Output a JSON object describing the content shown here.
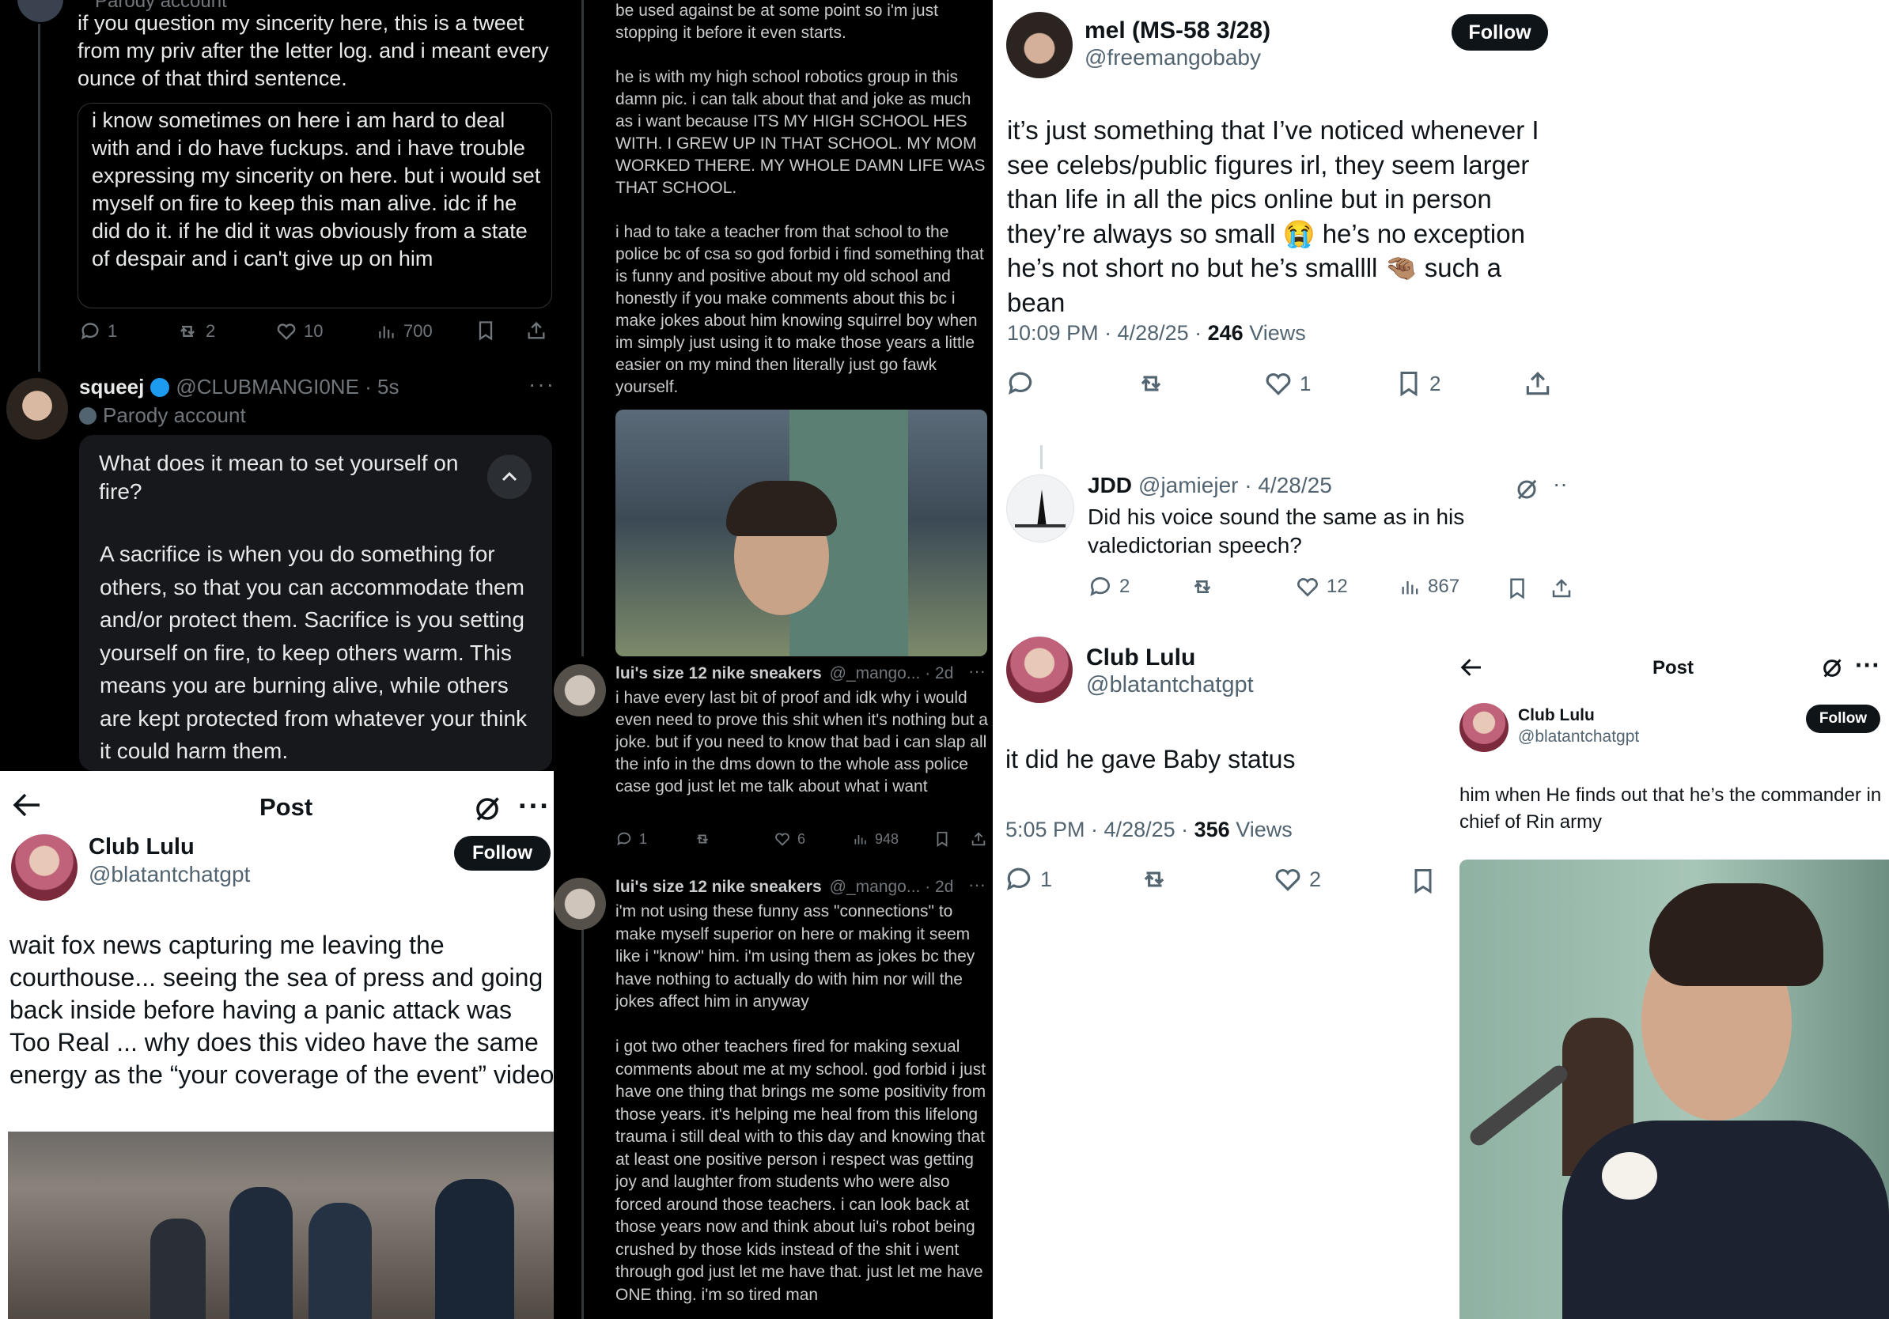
{
  "p1": {
    "prev_label": "Parody account",
    "tweet_text": "if you question my sincerity here, this is a tweet from my priv after the letter log. and i meant every ounce of that third sentence.",
    "quote_text": "i know sometimes on here i am hard to deal with and i do have fuckups. and i have trouble expressing my sincerity on here. but i would set myself on fire to keep this man alive. idc if he did do it. if he did it was obviously from a state of despair and i can't give up on him",
    "metrics": {
      "replies": "1",
      "reposts": "2",
      "likes": "10",
      "views": "700"
    },
    "reply": {
      "name": "squeej",
      "handle": "@CLUBMANGI0NE · 5s",
      "badge": "Parody account",
      "question": "What does it mean to set yourself on fire?",
      "answer": "A sacrifice is when you do something for others, so that you can accommodate them and/or protect them. Sacrifice is you setting yourself on fire, to keep others warm. This means you are burning alive, while others are kept protected from whatever your think it could harm them."
    }
  },
  "p2": {
    "header": "Post",
    "name": "Club Lulu",
    "handle": "@blatantchatgpt",
    "follow": "Follow",
    "text": "wait fox news capturing me leaving the courthouse... seeing the sea of press and going back inside before having a panic attack was Too Real ... why does this video have the same energy as the “your coverage of the event” video"
  },
  "p3": {
    "top_text": "be used against be at some point so i'm just stopping it before it even starts.",
    "para1": "he is with my high school robotics group in this damn pic. i can talk about that and joke as much as i want because ITS MY HIGH SCHOOL HES WITH. I GREW UP IN THAT SCHOOL. MY MOM WORKED THERE. MY WHOLE DAMN LIFE WAS THAT SCHOOL.",
    "para2": "i had to take a teacher from that school to the police bc of csa so god forbid i find something that is funny and positive about my old school and honestly if you make comments about this bc i make jokes about him knowing squirrel boy when im simply just using it to make those years a little easier on my mind then literally just go fawk yourself.",
    "tweet2": {
      "name": "lui's size 12 nike sneakers",
      "meta": "@_mango... · 2d",
      "text": "i have every last bit of proof and idk why i would even need to prove this shit when it's nothing but a joke. but if you need to know that bad i can slap all the info in the dms down to the whole ass police case god just let me talk about what i want",
      "metrics": {
        "replies": "1",
        "likes": "6",
        "views": "948"
      }
    },
    "tweet3": {
      "name": "lui's size 12 nike sneakers",
      "meta": "@_mango... · 2d",
      "text": "i'm not using these funny ass \"connections\" to make myself superior on here or making it seem like i \"know\" him. i'm using them as jokes bc they have nothing to actually do with him nor will the jokes affect him in anyway",
      "text2": "i got two other teachers fired for making sexual comments about me at my school. god forbid i just have one thing that brings me some positivity from those years. it's helping me heal from this lifelong trauma i still deal with to this day and knowing that at least one positive person i respect was getting joy and laughter from students who were also forced around those teachers. i can look back at those years now and think about lui's robot being crushed by those kids instead of the shit i went through god just let me have that. just let me have ONE thing. i'm so tired man"
    }
  },
  "p4": {
    "name": "mel (MS-58 3/28)",
    "handle": "@freemangobaby",
    "follow": "Follow",
    "text": "it’s just something that I’ve noticed whenever I see celebs/public figures irl, they seem larger than life in all the pics online but in person they’re always so small 😭 he’s no exception he’s not short no but he’s smallll 🤏🏽 such a bean",
    "time": "10:09 PM · 4/28/25 · ",
    "views_count": "246",
    "views_label": " Views",
    "metrics": {
      "likes": "1",
      "bookmarks": "2"
    },
    "reply": {
      "name": "JDD",
      "handle": "@jamiejer · 4/28/25",
      "text": "Did his voice sound the same as in his valedictorian speech?",
      "metrics": {
        "replies": "2",
        "likes": "12",
        "views": "867"
      }
    }
  },
  "p5": {
    "name": "Club Lulu",
    "handle": "@blatantchatgpt",
    "text": "it did he gave Baby status",
    "time": "5:05 PM · 4/28/25 · ",
    "views_count": "356",
    "views_label": " Views",
    "metrics": {
      "replies": "1",
      "likes": "2"
    }
  },
  "p6": {
    "header": "Post",
    "name": "Club Lulu",
    "handle": "@blatantchatgpt",
    "follow": "Follow",
    "text": "him when He finds out that he’s the commander in chief of Rin army"
  }
}
